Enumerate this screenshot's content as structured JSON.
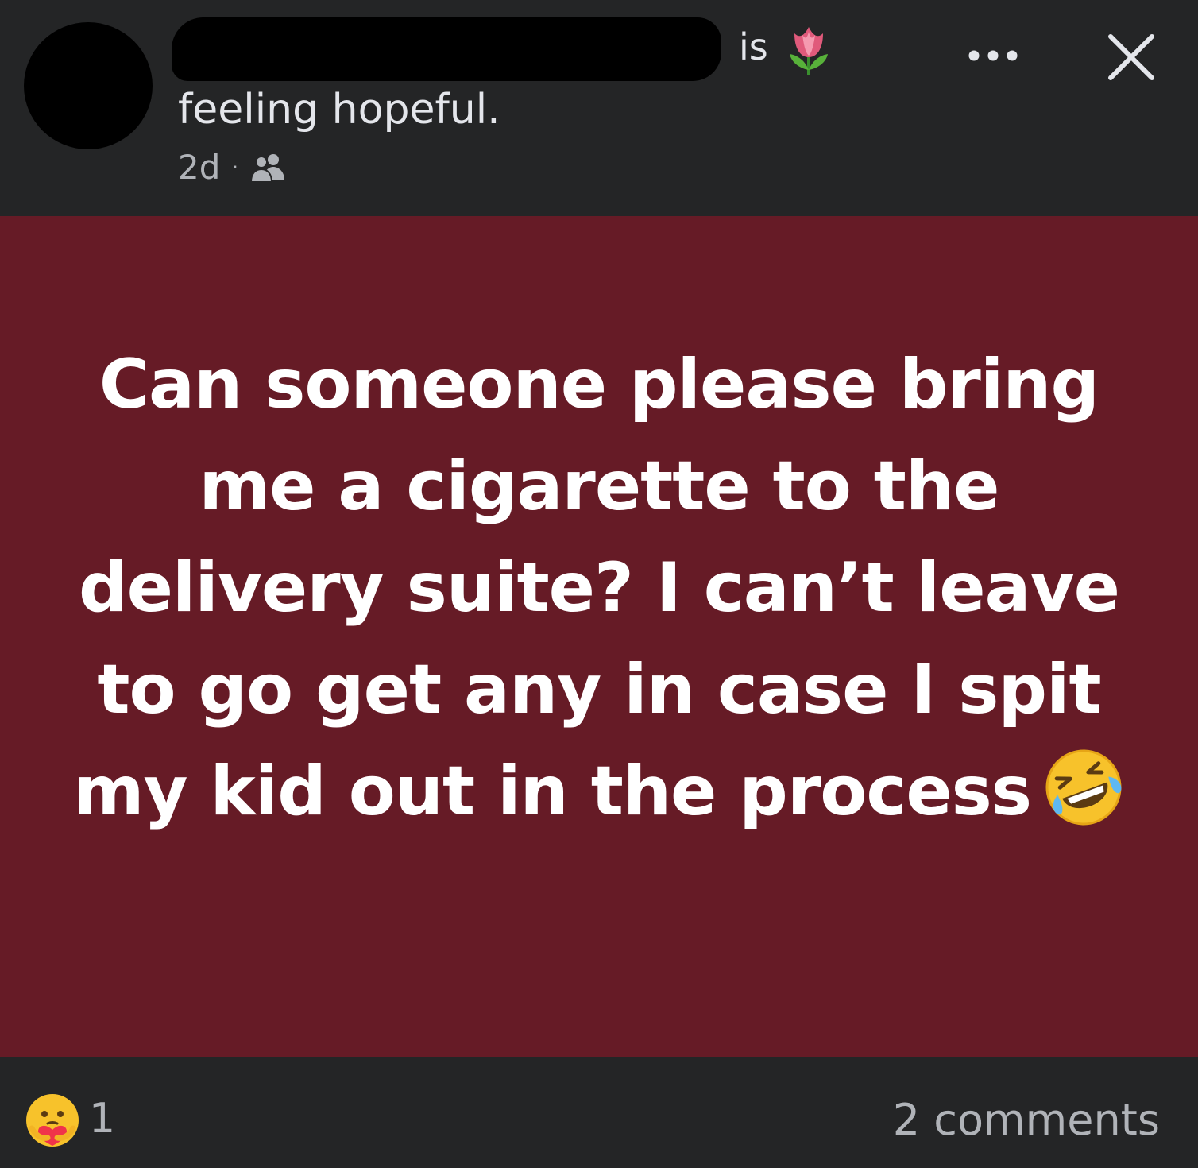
{
  "header": {
    "verb": "is",
    "feeling": "feeling hopeful.",
    "timestamp": "2d",
    "separator": "·",
    "audience_icon": "friends-icon",
    "status_icon": "tulip-icon",
    "more_icon": "more-horizontal-icon",
    "close_icon": "close-icon"
  },
  "post": {
    "text": "Can someone please bring me a cigarette to the delivery suite? I can’t leave to go get any in case I spit my kid out in the process",
    "background_color": "#661b26",
    "emoji_icon": "rolling-on-floor-laughing-icon"
  },
  "footer": {
    "reaction_icon": "care-reaction-icon",
    "reaction_count": "1",
    "comments": "2 comments"
  }
}
